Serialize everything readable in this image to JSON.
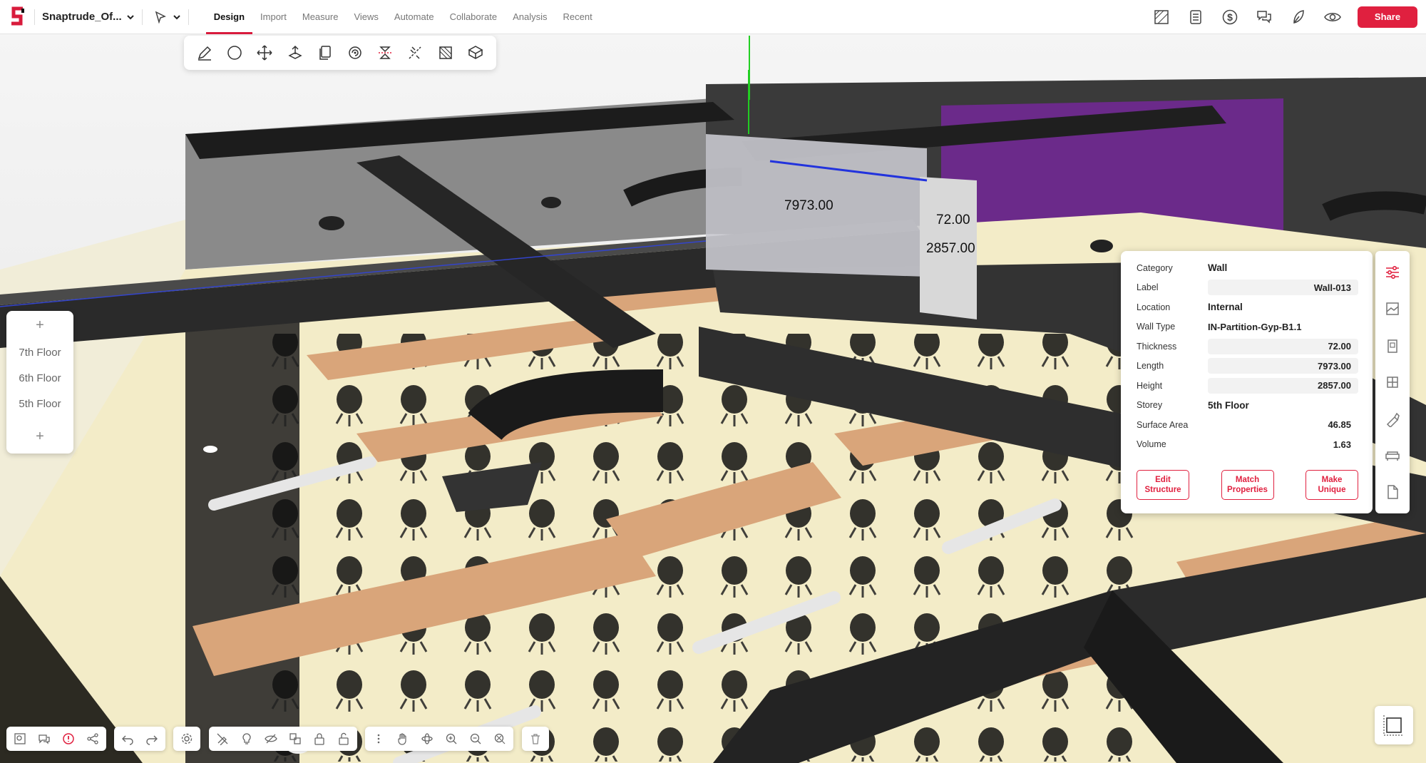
{
  "app": {
    "project_name": "Snaptrude_Of...",
    "tabs": [
      "Design",
      "Import",
      "Measure",
      "Views",
      "Automate",
      "Collaborate",
      "Analysis",
      "Recent"
    ],
    "active_tab": "Design",
    "share_label": "Share"
  },
  "floors": {
    "items": [
      "7th Floor",
      "6th Floor",
      "5th Floor"
    ],
    "add_symbol": "+"
  },
  "dimensions": {
    "length": "7973.00",
    "thickness": "72.00",
    "height": "2857.00"
  },
  "properties": {
    "rows": [
      {
        "key": "Category",
        "value": "Wall"
      },
      {
        "key": "Label",
        "value": "Wall-013"
      },
      {
        "key": "Location",
        "value": "Internal"
      },
      {
        "key": "Wall Type",
        "value": "IN-Partition-Gyp-B1.1"
      },
      {
        "key": "Thickness",
        "value": "72.00"
      },
      {
        "key": "Length",
        "value": "7973.00"
      },
      {
        "key": "Height",
        "value": "2857.00"
      },
      {
        "key": "Storey",
        "value": "5th Floor"
      },
      {
        "key": "Surface Area",
        "value": "46.85"
      },
      {
        "key": "Volume",
        "value": "1.63"
      }
    ],
    "actions": [
      {
        "line1": "Edit",
        "line2": "Structure"
      },
      {
        "line1": "Match",
        "line2": "Properties"
      },
      {
        "line1": "Make",
        "line2": "Unique"
      }
    ]
  },
  "colors": {
    "accent": "#e0203f",
    "floor": "#f3ecc8",
    "duct": "#2a2a2a",
    "desk": "#d9a57a"
  }
}
